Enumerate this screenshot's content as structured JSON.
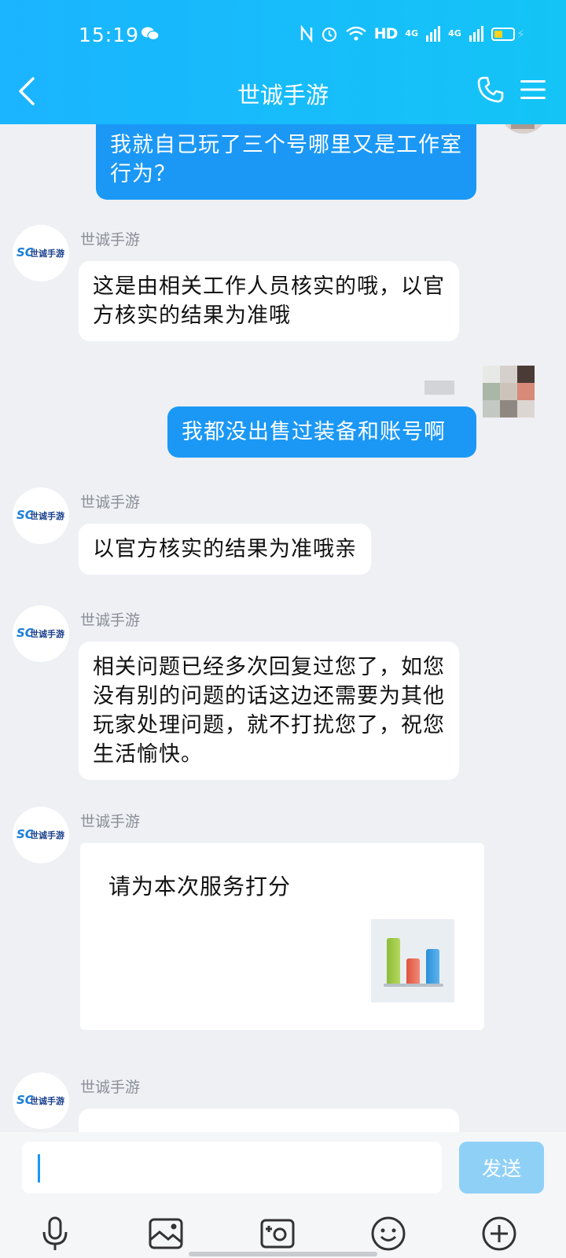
{
  "status_bar": {
    "time": "15:19",
    "network": "HD",
    "signal_label": "4G"
  },
  "header": {
    "title": "世诚手游"
  },
  "messages": {
    "m1": {
      "text": "我就自己玩了三个号哪里又是工作室行为？"
    },
    "m2": {
      "sender": "世诚手游",
      "text": "这是由相关工作人员核实的哦，以官方核实的结果为准哦"
    },
    "m3": {
      "text": "我都没出售过装备和账号啊"
    },
    "m4": {
      "sender": "世诚手游",
      "text": "以官方核实的结果为准哦亲"
    },
    "m5": {
      "sender": "世诚手游",
      "text": "相关问题已经多次回复过您了，如您没有别的问题的话这边还需要为其他玩家处理问题，就不打扰您了，祝您生活愉快。"
    },
    "m6": {
      "sender": "世诚手游",
      "card_title": "请为本次服务打分"
    },
    "m7": {
      "sender": "世诚手游"
    }
  },
  "avatar_logo": {
    "mark": "SC",
    "name": "世诚手游"
  },
  "input": {
    "value": "",
    "placeholder": "",
    "send_label": "发送"
  },
  "colors": {
    "header": "#16baf9",
    "outgoing_bubble": "#1b98f5",
    "background": "#eef0f4",
    "send_disabled": "#8fd0f7"
  },
  "toolbar": {
    "icons": [
      "microphone-icon",
      "image-icon",
      "camera-icon",
      "emoji-icon",
      "plus-icon"
    ]
  }
}
